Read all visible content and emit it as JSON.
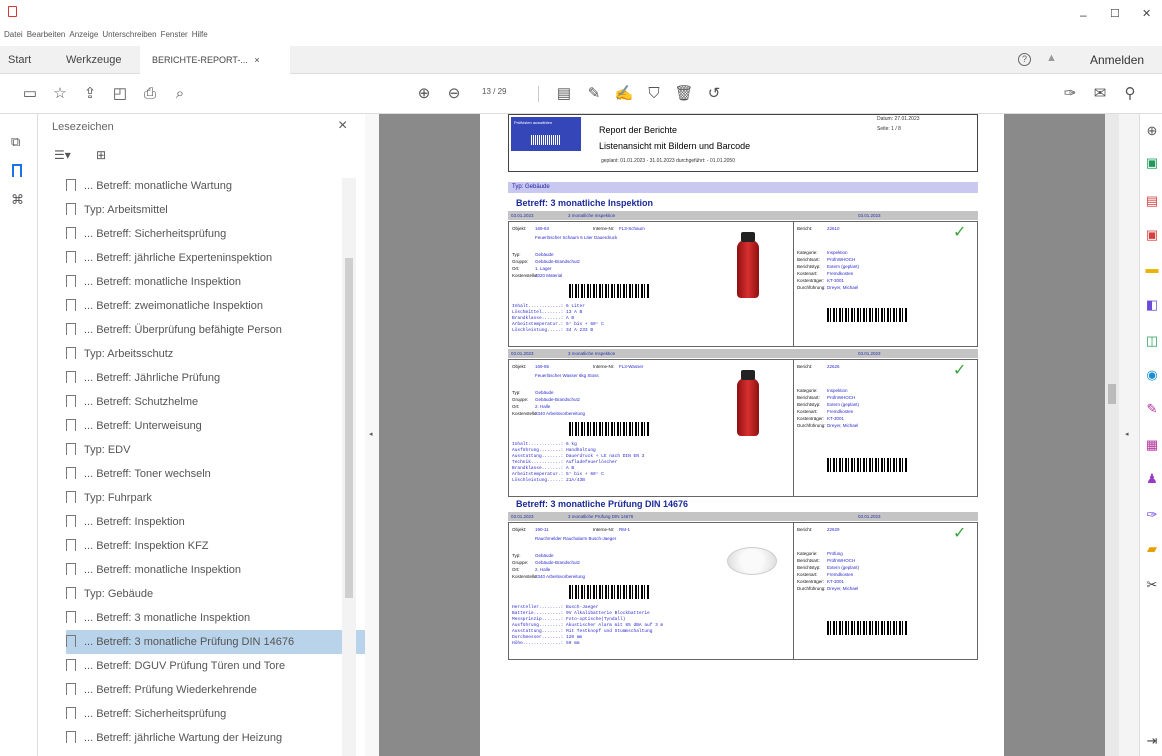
{
  "window": {
    "minimize": "–",
    "maximize": "☐",
    "close": "✕"
  },
  "menu": [
    "Datei",
    "Bearbeiten",
    "Anzeige",
    "Unterschreiben",
    "Fenster",
    "Hilfe"
  ],
  "tabs": {
    "start": "Start",
    "tools": "Werkzeuge",
    "document": "BERICHTE-REPORT-...",
    "document_close": "×",
    "signin": "Anmelden"
  },
  "toolbar": {
    "page_current": "13",
    "page_total": "/ 29"
  },
  "bookmarks": {
    "header": "Lesezeichen",
    "close": "×",
    "items": [
      "... Betreff: monatliche Wartung",
      "Typ: Arbeitsmittel",
      "... Betreff: Sicherheitsprüfung",
      "... Betreff: jährliche Experteninspektion",
      "... Betreff: monatliche Inspektion",
      "... Betreff: zweimonatliche Inspektion",
      "... Betreff: Überprüfung befähigte Person",
      "Typ: Arbeitsschutz",
      "... Betreff: Jährliche Prüfung",
      "... Betreff: Schutzhelme",
      "... Betreff: Unterweisung",
      "Typ: EDV",
      "... Betreff: Toner wechseln",
      "Typ: Fuhrpark",
      "... Betreff: Inspektion",
      "... Betreff: Inspektion KFZ",
      "... Betreff: monatliche Inspektion",
      "Typ: Gebäude",
      "... Betreff: 3 monatliche Inspektion",
      "... Betreff: 3 monatliche Prüfung DIN 14676",
      "... Betreff: DGUV Prüfung Türen und Tore",
      "... Betreff: Prüfung Wiederkehrende",
      "... Betreff: Sicherheitsprüfung",
      "... Betreff: jährliche Wartung der Heizung"
    ],
    "selected_index": 19
  },
  "report": {
    "header_left": "Prüfkisten auswählen",
    "title": "Report der Berichte",
    "subtitle": "Listenansicht mit Bildern und Barcode",
    "range": "geplant: 01.01.2023 - 31.01.2023  durchgeführt: - 01.01.2050",
    "date_label": "Datum: 27.01.2023",
    "page_label": "Seite: 1 / 8",
    "type": "Typ: Gebäude",
    "sections": [
      {
        "betreff": "Betreff: 3 monatliche Inspektion",
        "entries": [
          {
            "bar_left": "03.01.2023",
            "bar_mid": "3 monatliche Inspektion",
            "bar_right": "03.01.2023",
            "objekt": "169-63",
            "intern": "FL3-Schaum",
            "name": "Feuerlöscher Schaum 6 Liter Dauerdruck",
            "typ": "Gebäude",
            "gruppe": "Gebäude-Brandschutz",
            "ort": "1. Lager",
            "kostenstelle": "4020 Material",
            "bericht": "22610",
            "kategorie": "Inspektion",
            "berichtsart": "PrüfnWHOCH",
            "berichtstyp": "Extern (geplant)",
            "kostenart": "Fremdkosten",
            "kostentraeger": "KT-3001",
            "durchfuehrung": "Dreyer, Michael",
            "specs": [
              "Inhalt............: 6 Liter",
              "Löschmittel.......: 13 A B",
              "Brandklasse.......: A B",
              "Arbeitstemperatur.: 5° bis + 60° C",
              "Löschleistung.....: 34 A 233 B"
            ]
          },
          {
            "bar_left": "03.01.2023",
            "bar_mid": "3 monatliche Inspektion",
            "bar_right": "03.01.2023",
            "objekt": "169-65",
            "intern": "FL3-Wasser",
            "name": "Feuerlöscher Wasser 6kg Stoss",
            "typ": "Gebäude",
            "gruppe": "Gebäude-Brandschutz",
            "ort": "2. Halle",
            "kostenstelle": "2340 Arbeitsvorbereitung",
            "bericht": "22626",
            "kategorie": "Inspektion",
            "berichtsart": "PrüfnWHOCH",
            "berichtstyp": "Extern (geplant)",
            "kostenart": "Fremdkosten",
            "kostentraeger": "KT-3001",
            "durchfuehrung": "Dreyer, Michael",
            "specs": [
              "Inhalt............: 6 kg",
              "Ausführung........: Handhaltung",
              "Ausstattung.......: Dauerdruck + LE nach DIN EN 3",
              "Technik...........: Aufladefeuerlöscher",
              "Brandklasse.......: A B",
              "Arbeitstemperatur.: 5° bis + 60° C",
              "Löschleistung.....: 21A/43B"
            ]
          }
        ]
      },
      {
        "betreff": "Betreff: 3 monatliche Prüfung DIN 14676",
        "entries": [
          {
            "bar_left": "03.01.2023",
            "bar_mid": "3 monatliche Prüfung DIN 14676",
            "bar_right": "03.01.2023",
            "objekt": "190-11",
            "intern": "RM-1",
            "name": "Rauchmelder Rauchalarm Busch-Jaeger",
            "typ": "Gebäude",
            "gruppe": "Gebäude-Brandschutz",
            "ort": "2. Halle",
            "kostenstelle": "2340 Arbeitsvorbereitung",
            "bericht": "22629",
            "kategorie": "Prüfung",
            "berichtsart": "PrüfnWHOCH",
            "berichtstyp": "Extern (geplant)",
            "kostenart": "Fremdkosten",
            "kostentraeger": "KT-3001",
            "durchfuehrung": "Dreyer, Michael",
            "specs": [
              "Hersteller........: Busch-Jaeger",
              "Batterie..........: 9V Alkalibatterie Blockbatterie",
              "Messprinzip.......: Foto-optische(Tyndall)",
              "Ausführung........: Akustischer Alarm mit 85 dBA auf 3 m",
              "Ausstattung.......: Mit Testknopf und Stummschaltung",
              "Durchmesser.......: 120 mm",
              "Höhe..............: 50 mm"
            ]
          }
        ]
      }
    ]
  }
}
